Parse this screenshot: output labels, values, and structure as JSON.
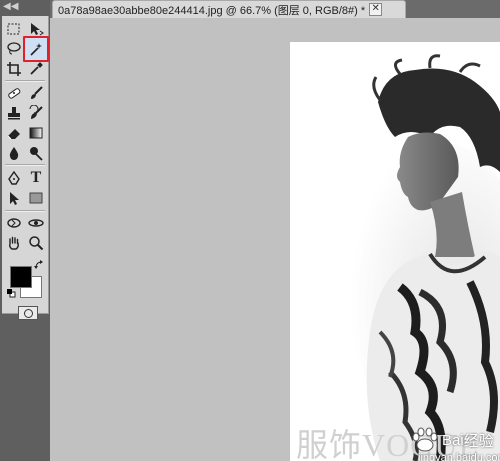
{
  "document_tab": {
    "title": "0a78a98ae30abbe80e244414.jpg @ 66.7% (图层 0, RGB/8#) *",
    "close_label": "✕"
  },
  "panel": {
    "collapse_label": "◀◀"
  },
  "toolbox": {
    "tools": [
      {
        "name": "rectangular-marquee-tool",
        "icon": "rectangular-marquee-icon"
      },
      {
        "name": "move-tool",
        "icon": "move-icon"
      },
      {
        "name": "lasso-tool",
        "icon": "lasso-icon"
      },
      {
        "name": "magic-wand-tool",
        "icon": "magic-wand-icon",
        "selected": true,
        "highlight_color": "#e0202a"
      },
      {
        "name": "crop-tool",
        "icon": "crop-icon"
      },
      {
        "name": "eyedropper-tool",
        "icon": "eyedropper-icon"
      },
      {
        "name": "spot-healing-tool",
        "icon": "bandage-icon"
      },
      {
        "name": "brush-tool",
        "icon": "brush-icon"
      },
      {
        "name": "clone-stamp-tool",
        "icon": "stamp-icon"
      },
      {
        "name": "history-brush-tool",
        "icon": "history-brush-icon"
      },
      {
        "name": "eraser-tool",
        "icon": "eraser-icon"
      },
      {
        "name": "gradient-tool",
        "icon": "gradient-icon"
      },
      {
        "name": "blur-tool",
        "icon": "drop-icon"
      },
      {
        "name": "dodge-tool",
        "icon": "dodge-icon"
      },
      {
        "name": "pen-tool",
        "icon": "pen-icon"
      },
      {
        "name": "type-tool",
        "icon": "type-icon",
        "label": "T"
      },
      {
        "name": "path-selection-tool",
        "icon": "arrow-icon"
      },
      {
        "name": "shape-tool",
        "icon": "rectangle-shape-icon"
      },
      {
        "name": "3d-rotate-tool",
        "icon": "3d-rotate-icon"
      },
      {
        "name": "3d-orbit-tool",
        "icon": "3d-orbit-icon"
      },
      {
        "name": "hand-tool",
        "icon": "hand-icon"
      },
      {
        "name": "zoom-tool",
        "icon": "magnifier-icon"
      }
    ],
    "foreground_color": "#000000",
    "background_color": "#ffffff"
  },
  "canvas": {
    "workspace_color": "#c1c1c1",
    "watermark": "服饰VOGUE",
    "baidu_logo_text": "Bai",
    "baidu_label": "经验",
    "baidu_url": "jingyan.baidu.com"
  }
}
